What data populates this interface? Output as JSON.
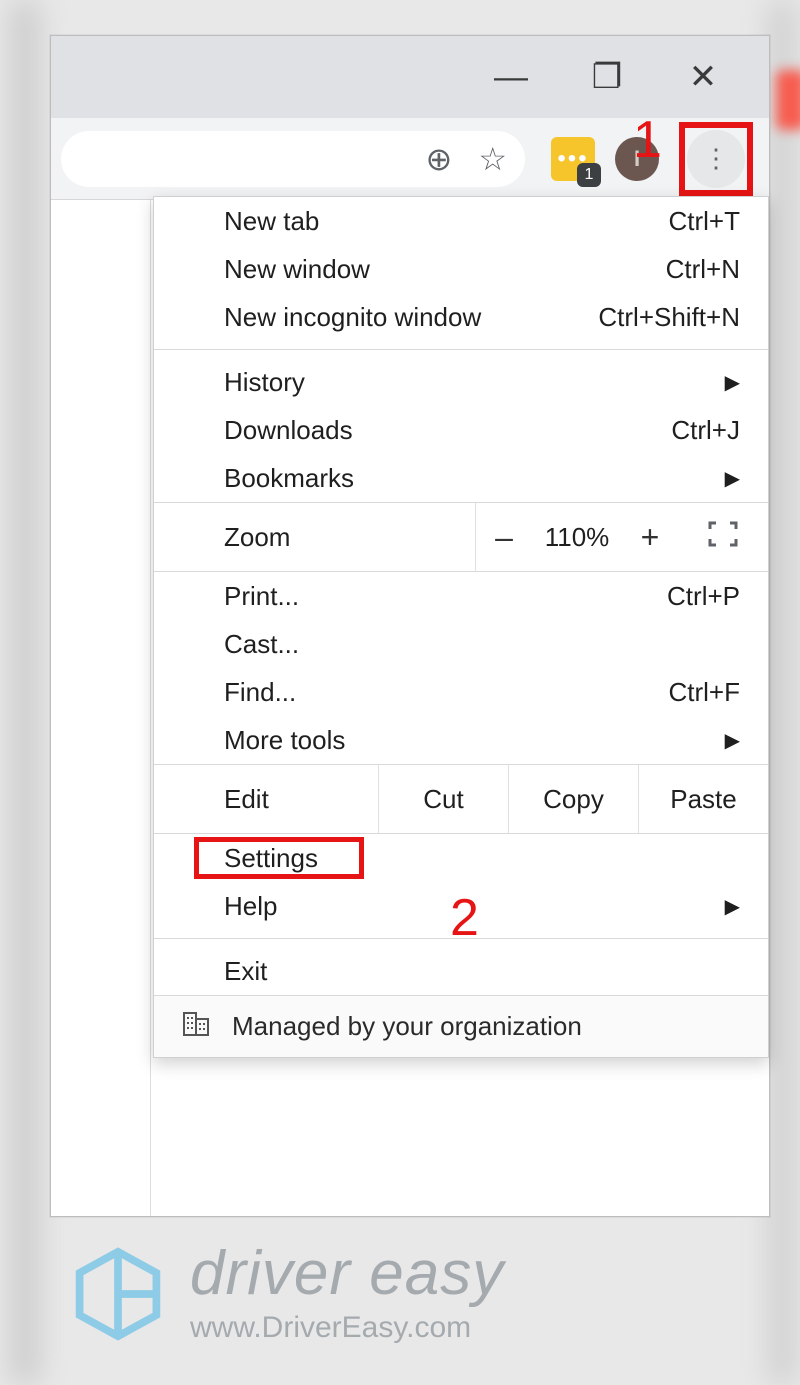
{
  "window_controls": {
    "minimize": "—",
    "maximize": "❐",
    "close": "✕"
  },
  "toolbar": {
    "zoom_icon": "⊕",
    "star_icon": "☆",
    "ext_badge_count": "1",
    "avatar_letter": "I",
    "kebab": "⋮"
  },
  "menu": {
    "new_tab": {
      "label": "New tab",
      "shortcut": "Ctrl+T"
    },
    "new_window": {
      "label": "New window",
      "shortcut": "Ctrl+N"
    },
    "new_incognito": {
      "label": "New incognito window",
      "shortcut": "Ctrl+Shift+N"
    },
    "history": {
      "label": "History"
    },
    "downloads": {
      "label": "Downloads",
      "shortcut": "Ctrl+J"
    },
    "bookmarks": {
      "label": "Bookmarks"
    },
    "zoom": {
      "label": "Zoom",
      "minus": "–",
      "value": "110%",
      "plus": "+",
      "fullscreen": "⛶"
    },
    "print": {
      "label": "Print...",
      "shortcut": "Ctrl+P"
    },
    "cast": {
      "label": "Cast..."
    },
    "find": {
      "label": "Find...",
      "shortcut": "Ctrl+F"
    },
    "more_tools": {
      "label": "More tools"
    },
    "edit": {
      "label": "Edit",
      "cut": "Cut",
      "copy": "Copy",
      "paste": "Paste"
    },
    "settings": {
      "label": "Settings"
    },
    "help": {
      "label": "Help"
    },
    "exit": {
      "label": "Exit"
    },
    "managed": {
      "label": "Managed by your organization"
    },
    "submenu_arrow": "▶"
  },
  "annotations": {
    "step1": "1",
    "step2": "2"
  },
  "watermark": {
    "brand": "driver easy",
    "url": "www.DriverEasy.com"
  }
}
